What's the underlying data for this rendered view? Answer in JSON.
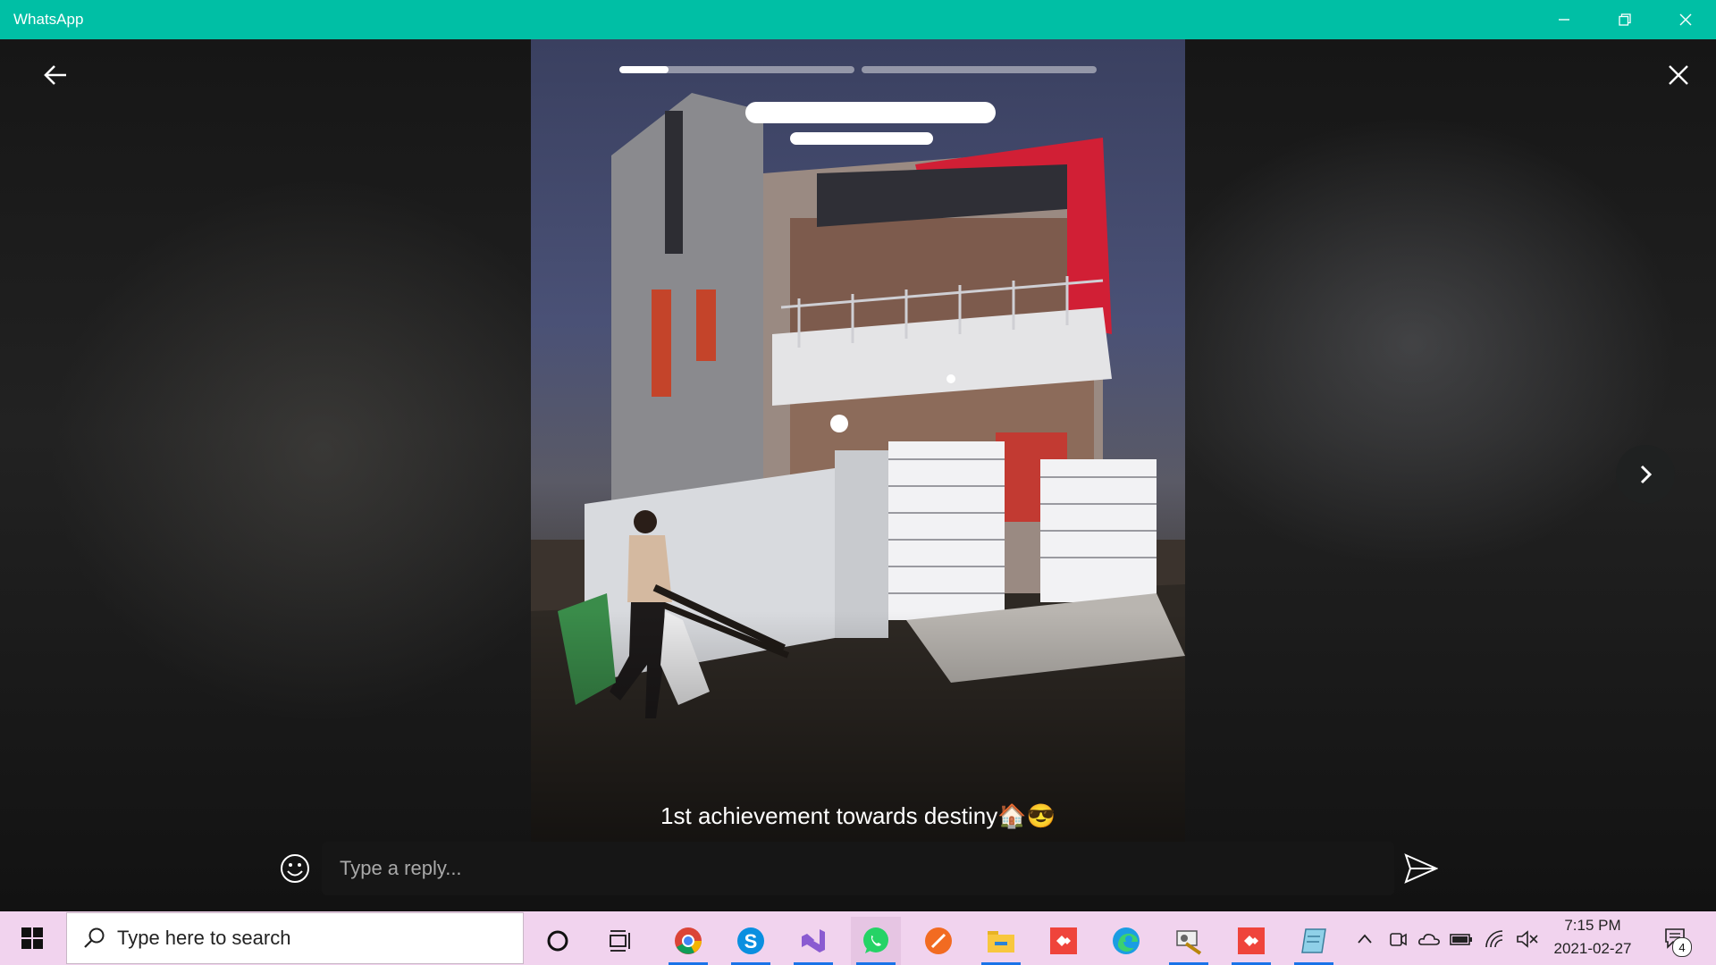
{
  "window": {
    "title": "WhatsApp",
    "controls": [
      "minimize-icon",
      "restore-icon",
      "close-icon"
    ]
  },
  "status": {
    "contact_name": "",
    "time": "",
    "progress": [
      0.21,
      0
    ],
    "caption": "1st achievement towards destiny🏠😎"
  },
  "reply": {
    "placeholder": "Type a reply...",
    "value": ""
  },
  "icons": {
    "back": "back-arrow-icon",
    "close": "close-icon",
    "next": "chevron-right-icon",
    "emoji": "emoji-icon",
    "send": "send-icon"
  },
  "taskbar": {
    "search_placeholder": "Type here to search",
    "apps": [
      "cortana-icon",
      "task-view-icon",
      "chrome-icon",
      "skype-icon",
      "visual-studio-icon",
      "whatsapp-icon",
      "sketch-app-icon",
      "file-explorer-icon",
      "anydesk-icon",
      "edge-icon",
      "tool-icon",
      "anydesk-icon",
      "notepad-icon"
    ],
    "tray": [
      "chevron-up-icon",
      "meet-now-icon",
      "onedrive-icon",
      "battery-icon",
      "wifi-icon",
      "volume-muted-icon"
    ],
    "clock_time": "7:15 PM",
    "clock_date": "2021-02-27",
    "notification_count": "4"
  },
  "colors": {
    "titlebar": "#00bfa5",
    "taskbar": "#f1d3ee",
    "accent": "#1a73e8"
  }
}
